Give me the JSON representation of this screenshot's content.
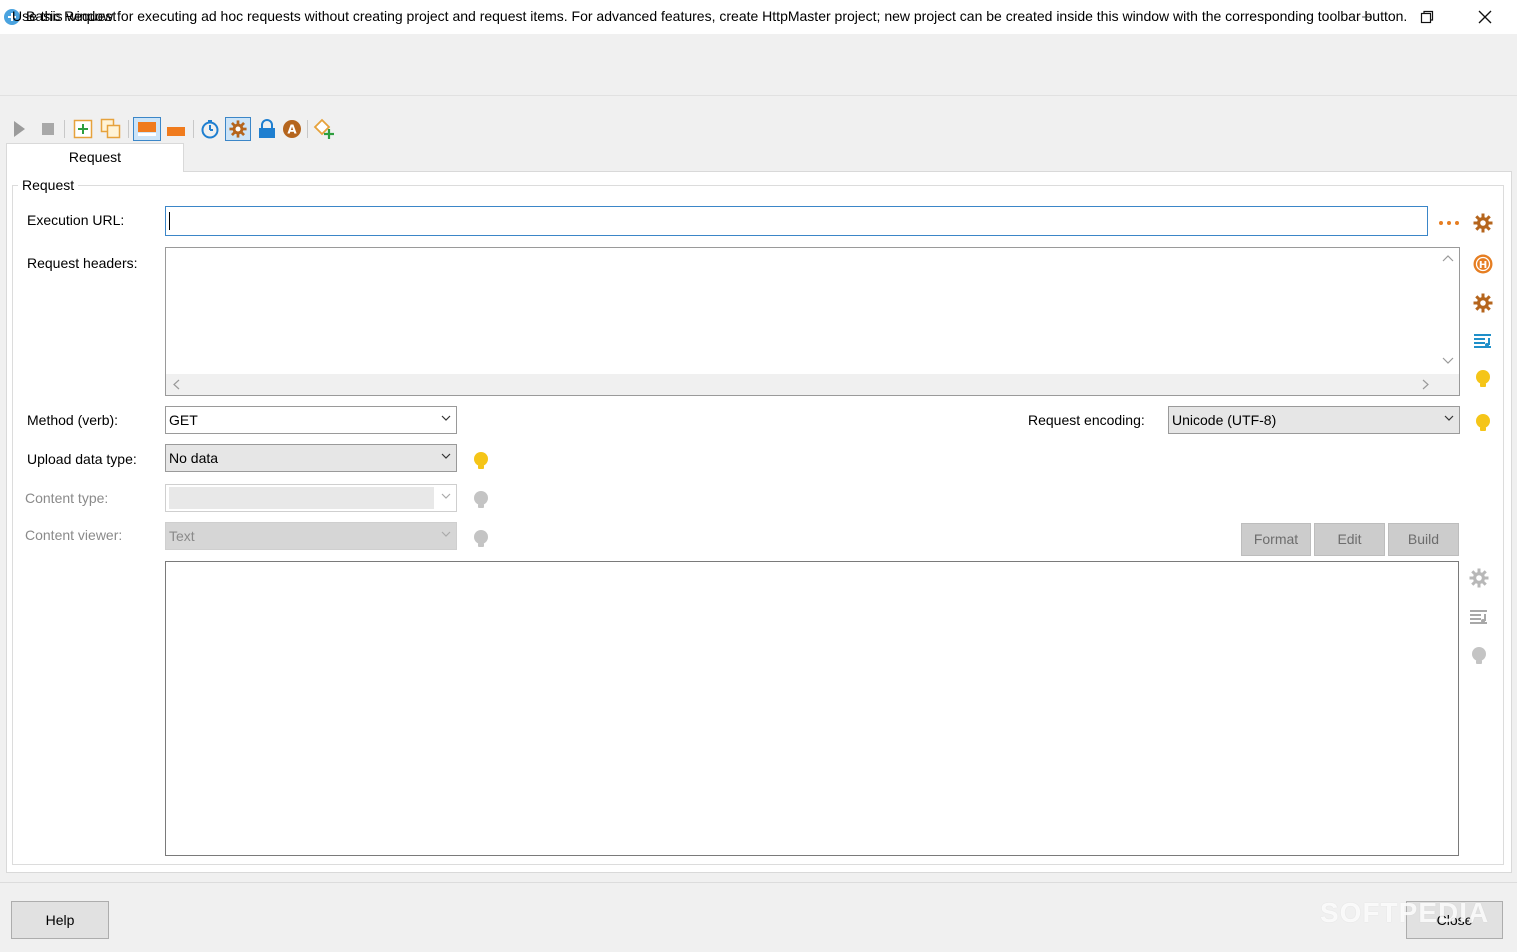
{
  "window": {
    "title": "Basic Request",
    "description": "Use this window for executing ad hoc requests without creating project and request items. For advanced features, create HttpMaster project; new project can be created inside this window with the corresponding toolbar button."
  },
  "toolbar": {
    "icons": [
      "play-icon",
      "stop-icon",
      "add-project-icon",
      "copy-icon",
      "layout-top-icon",
      "layout-bottom-icon",
      "timer-icon",
      "settings-icon",
      "lock-icon",
      "account-icon",
      "add-diamond-icon"
    ]
  },
  "tabs": [
    {
      "label": "Request",
      "active": true
    }
  ],
  "group": {
    "title": "Request"
  },
  "form": {
    "execution_url_label": "Execution URL:",
    "execution_url_value": "",
    "request_headers_label": "Request headers:",
    "method_label": "Method (verb):",
    "method_value": "GET",
    "request_encoding_label": "Request encoding:",
    "request_encoding_value": "Unicode (UTF-8)",
    "upload_data_type_label": "Upload data type:",
    "upload_data_type_value": "No data",
    "content_type_label": "Content type:",
    "content_type_value": "",
    "content_viewer_label": "Content viewer:",
    "content_viewer_value": "Text"
  },
  "editor_buttons": {
    "format": "Format",
    "edit": "Edit",
    "build": "Build"
  },
  "dialog": {
    "help": "Help",
    "close": "Close"
  },
  "watermark": "SOFTPEDIA",
  "colors": {
    "accent": "#3b86c8",
    "orange": "#e67e22",
    "bulb": "#f5c518",
    "brown": "#b5651d"
  }
}
